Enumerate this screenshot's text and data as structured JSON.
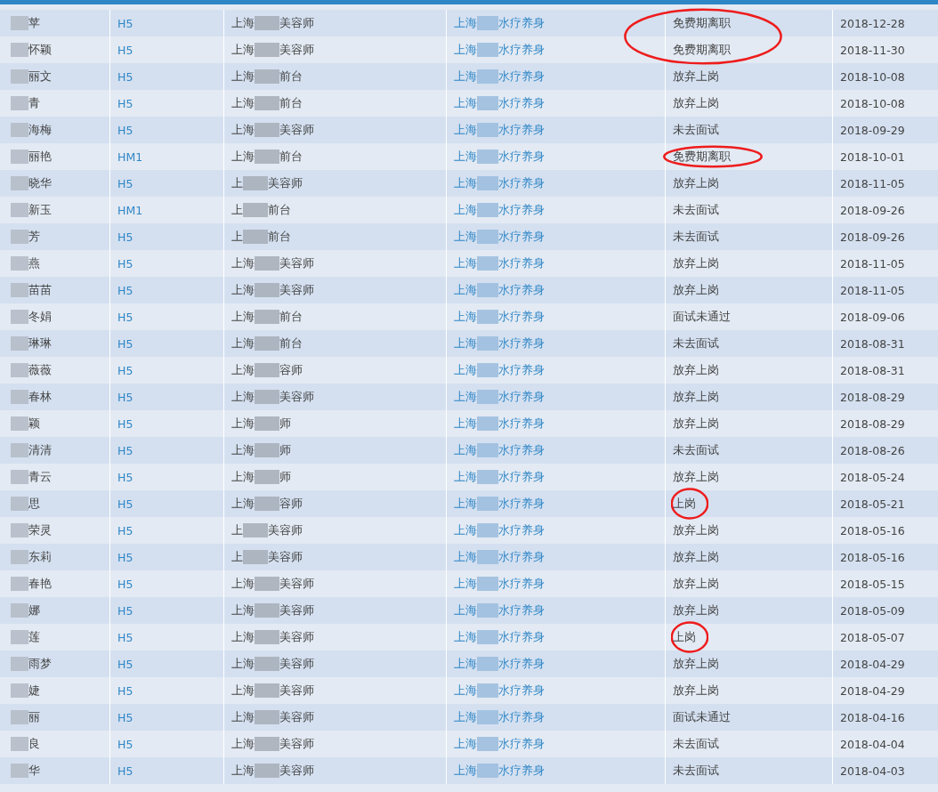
{
  "rows": [
    {
      "name": "苹",
      "code": "H5",
      "position_prefix": "上海",
      "position_suffix": "美容师",
      "store_prefix": "上海",
      "store_suffix": "水疗养身",
      "status": "免费期离职",
      "date": "2018-12-28",
      "circled": true
    },
    {
      "name": "怀颖",
      "code": "H5",
      "position_prefix": "上海",
      "position_suffix": "美容师",
      "store_prefix": "上海",
      "store_suffix": "水疗养身",
      "status": "免费期离职",
      "date": "2018-11-30",
      "circled": true
    },
    {
      "name": "丽文",
      "code": "H5",
      "position_prefix": "上海",
      "position_suffix": "前台",
      "store_prefix": "上海",
      "store_suffix": "水疗养身",
      "status": "放弃上岗",
      "date": "2018-10-08",
      "circled": false
    },
    {
      "name": "青",
      "code": "H5",
      "position_prefix": "上海",
      "position_suffix": "前台",
      "store_prefix": "上海",
      "store_suffix": "水疗养身",
      "status": "放弃上岗",
      "date": "2018-10-08",
      "circled": false
    },
    {
      "name": "海梅",
      "code": "H5",
      "position_prefix": "上海",
      "position_suffix": "美容师",
      "store_prefix": "上海",
      "store_suffix": "水疗养身",
      "status": "未去面试",
      "date": "2018-09-29",
      "circled": false
    },
    {
      "name": "丽艳",
      "code": "HM1",
      "position_prefix": "上海",
      "position_suffix": "前台",
      "store_prefix": "上海",
      "store_suffix": "水疗养身",
      "status": "免费期离职",
      "date": "2018-10-01",
      "circled": true
    },
    {
      "name": "晓华",
      "code": "H5",
      "position_prefix": "上",
      "position_suffix": "美容师",
      "store_prefix": "上海",
      "store_suffix": "水疗养身",
      "status": "放弃上岗",
      "date": "2018-11-05",
      "circled": false
    },
    {
      "name": "新玉",
      "code": "HM1",
      "position_prefix": "上",
      "position_suffix": "前台",
      "store_prefix": "上海",
      "store_suffix": "水疗养身",
      "status": "未去面试",
      "date": "2018-09-26",
      "circled": false
    },
    {
      "name": "芳",
      "code": "H5",
      "position_prefix": "上",
      "position_suffix": "前台",
      "store_prefix": "上海",
      "store_suffix": "水疗养身",
      "status": "未去面试",
      "date": "2018-09-26",
      "circled": false
    },
    {
      "name": "燕",
      "code": "H5",
      "position_prefix": "上海",
      "position_suffix": "美容师",
      "store_prefix": "上海",
      "store_suffix": "水疗养身",
      "status": "放弃上岗",
      "date": "2018-11-05",
      "circled": false
    },
    {
      "name": "苗苗",
      "code": "H5",
      "position_prefix": "上海",
      "position_suffix": "美容师",
      "store_prefix": "上海",
      "store_suffix": "水疗养身",
      "status": "放弃上岗",
      "date": "2018-11-05",
      "circled": false
    },
    {
      "name": "冬娟",
      "code": "H5",
      "position_prefix": "上海",
      "position_suffix": "前台",
      "store_prefix": "上海",
      "store_suffix": "水疗养身",
      "status": "面试未通过",
      "date": "2018-09-06",
      "circled": false
    },
    {
      "name": "琳琳",
      "code": "H5",
      "position_prefix": "上海",
      "position_suffix": "前台",
      "store_prefix": "上海",
      "store_suffix": "水疗养身",
      "status": "未去面试",
      "date": "2018-08-31",
      "circled": false
    },
    {
      "name": "薇薇",
      "code": "H5",
      "position_prefix": "上海",
      "position_suffix": "容师",
      "store_prefix": "上海",
      "store_suffix": "水疗养身",
      "status": "放弃上岗",
      "date": "2018-08-31",
      "circled": false
    },
    {
      "name": "春林",
      "code": "H5",
      "position_prefix": "上海",
      "position_suffix": "美容师",
      "store_prefix": "上海",
      "store_suffix": "水疗养身",
      "status": "放弃上岗",
      "date": "2018-08-29",
      "circled": false
    },
    {
      "name": "颖",
      "code": "H5",
      "position_prefix": "上海",
      "position_suffix": "师",
      "store_prefix": "上海",
      "store_suffix": "水疗养身",
      "status": "放弃上岗",
      "date": "2018-08-29",
      "circled": false
    },
    {
      "name": "清清",
      "code": "H5",
      "position_prefix": "上海",
      "position_suffix": "师",
      "store_prefix": "上海",
      "store_suffix": "水疗养身",
      "status": "未去面试",
      "date": "2018-08-26",
      "circled": false
    },
    {
      "name": "青云",
      "code": "H5",
      "position_prefix": "上海",
      "position_suffix": "师",
      "store_prefix": "上海",
      "store_suffix": "水疗养身",
      "status": "放弃上岗",
      "date": "2018-05-24",
      "circled": false
    },
    {
      "name": "思",
      "code": "H5",
      "position_prefix": "上海",
      "position_suffix": "容师",
      "store_prefix": "上海",
      "store_suffix": "水疗养身",
      "status": "上岗",
      "date": "2018-05-21",
      "circled": true
    },
    {
      "name": "荣灵",
      "code": "H5",
      "position_prefix": "上",
      "position_suffix": "美容师",
      "store_prefix": "上海",
      "store_suffix": "水疗养身",
      "status": "放弃上岗",
      "date": "2018-05-16",
      "circled": false
    },
    {
      "name": "东莉",
      "code": "H5",
      "position_prefix": "上",
      "position_suffix": "美容师",
      "store_prefix": "上海",
      "store_suffix": "水疗养身",
      "status": "放弃上岗",
      "date": "2018-05-16",
      "circled": false
    },
    {
      "name": "春艳",
      "code": "H5",
      "position_prefix": "上海",
      "position_suffix": "美容师",
      "store_prefix": "上海",
      "store_suffix": "水疗养身",
      "status": "放弃上岗",
      "date": "2018-05-15",
      "circled": false
    },
    {
      "name": "娜",
      "code": "H5",
      "position_prefix": "上海",
      "position_suffix": "美容师",
      "store_prefix": "上海",
      "store_suffix": "水疗养身",
      "status": "放弃上岗",
      "date": "2018-05-09",
      "circled": false
    },
    {
      "name": "莲",
      "code": "H5",
      "position_prefix": "上海",
      "position_suffix": "美容师",
      "store_prefix": "上海",
      "store_suffix": "水疗养身",
      "status": "上岗",
      "date": "2018-05-07",
      "circled": true
    },
    {
      "name": "雨梦",
      "code": "H5",
      "position_prefix": "上海",
      "position_suffix": "美容师",
      "store_prefix": "上海",
      "store_suffix": "水疗养身",
      "status": "放弃上岗",
      "date": "2018-04-29",
      "circled": false
    },
    {
      "name": "婕",
      "code": "H5",
      "position_prefix": "上海",
      "position_suffix": "美容师",
      "store_prefix": "上海",
      "store_suffix": "水疗养身",
      "status": "放弃上岗",
      "date": "2018-04-29",
      "circled": false
    },
    {
      "name": "丽",
      "code": "H5",
      "position_prefix": "上海",
      "position_suffix": "美容师",
      "store_prefix": "上海",
      "store_suffix": "水疗养身",
      "status": "面试未通过",
      "date": "2018-04-16",
      "circled": false
    },
    {
      "name": "良",
      "code": "H5",
      "position_prefix": "上海",
      "position_suffix": "美容师",
      "store_prefix": "上海",
      "store_suffix": "水疗养身",
      "status": "未去面试",
      "date": "2018-04-04",
      "circled": false
    },
    {
      "name": "华",
      "code": "H5",
      "position_prefix": "上海",
      "position_suffix": "美容师",
      "store_prefix": "上海",
      "store_suffix": "水疗养身",
      "status": "未去面试",
      "date": "2018-04-03",
      "circled": false
    }
  ]
}
